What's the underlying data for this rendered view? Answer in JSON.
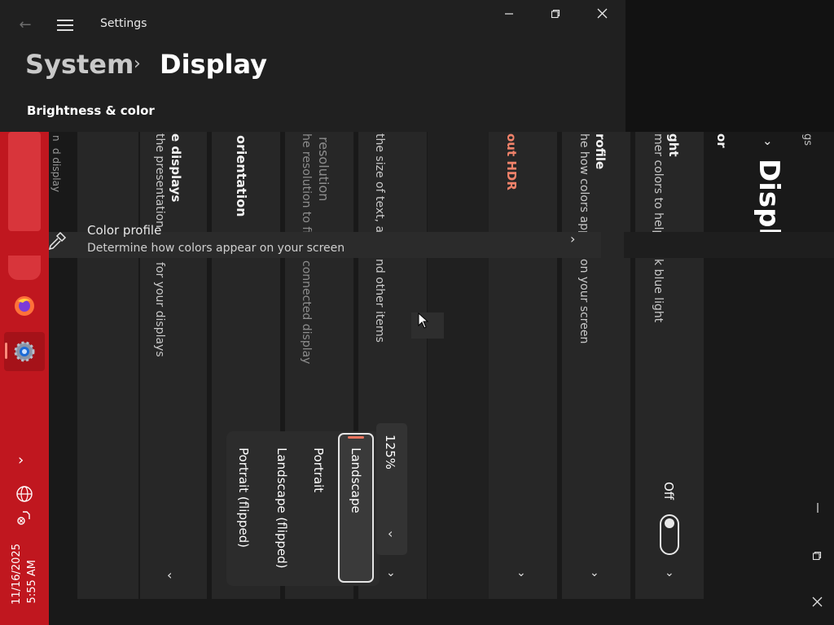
{
  "app": {
    "title": "Settings",
    "breadcrumb_root": "System",
    "breadcrumb_separator": "›",
    "breadcrumb_current": "Display",
    "section": "Brightness & color",
    "icons": {
      "back": "back-arrow-icon",
      "menu": "hamburger-menu-icon",
      "minimize": "minimize-icon",
      "maximize": "restore-icon",
      "close": "close-icon"
    }
  },
  "rotated": {
    "multiple_displays_title": "e displays",
    "multiple_displays_desc_top": "the presentation m",
    "multiple_displays_desc_bottom": "for your displays",
    "orientation_title": "orientation",
    "resolution_title": "resolution",
    "resolution_desc_top": "he resolution to fit",
    "resolution_desc_bottom": "connected display",
    "scale_desc_top": "the size of text, ap",
    "scale_desc_bottom": "nd other items",
    "hdr_link": "out HDR",
    "color_profile_title": "rofile",
    "color_profile_desc_top": "he how colors app",
    "color_profile_desc_bottom": "on your screen",
    "night_light_title": "ght",
    "night_light_desc_top": "mer colors to help",
    "night_light_desc_bottom": "k blue light",
    "brightness_label": "or",
    "page_display": "Displa",
    "settings_label": "gs",
    "left_fragment_1": "n",
    "left_fragment_2": "d display"
  },
  "color_profile_row": {
    "title": "Color profile",
    "description": "Determine how colors appear on your screen",
    "icon": "eyedropper-icon"
  },
  "orientation_dropdown": {
    "options": [
      "Landscape",
      "Portrait",
      "Landscape (flipped)",
      "Portrait (flipped)"
    ],
    "selected": "Landscape"
  },
  "scale": {
    "value": "125%"
  },
  "night_light_toggle": {
    "state": "Off"
  },
  "taskbar": {
    "time": "5:55 AM",
    "date": "11/16/2025",
    "icons": [
      "firefox-icon",
      "settings-gear-icon",
      "show-more-chevron-icon",
      "network-globe-icon",
      "volume-muted-icon"
    ],
    "color": "#c0171f"
  },
  "rotated_window_controls": {
    "minimize": "minimize-icon",
    "restore": "restore-icon",
    "close": "close-icon"
  }
}
